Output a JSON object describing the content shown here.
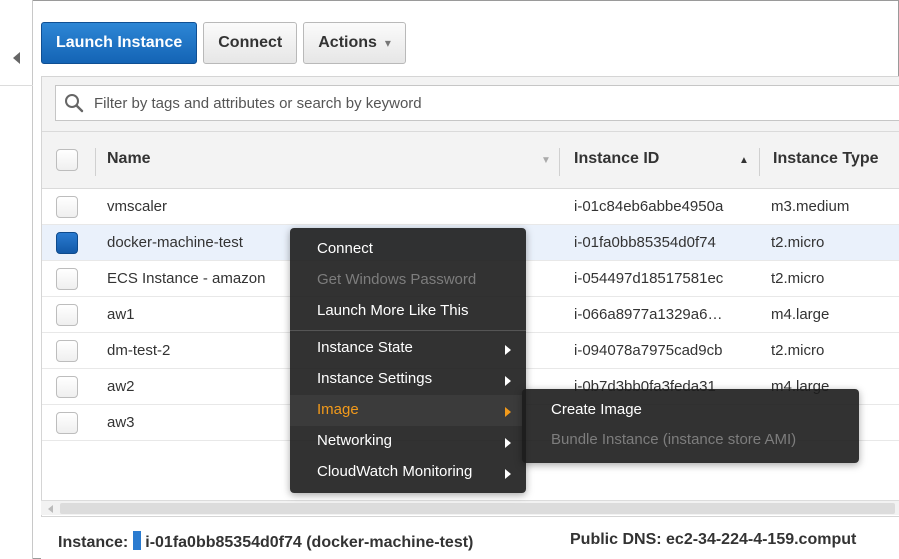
{
  "toolbar": {
    "launch_label": "Launch Instance",
    "connect_label": "Connect",
    "actions_label": "Actions",
    "actions_caret": "▾"
  },
  "filter": {
    "placeholder": "Filter by tags and attributes or search by keyword"
  },
  "table": {
    "columns": [
      "Name",
      "Instance ID",
      "Instance Type"
    ],
    "rows": [
      {
        "name": "vmscaler",
        "id": "i-01c84eb6abbe4950a",
        "type": "m3.medium",
        "selected": false
      },
      {
        "name": "docker-machine-test",
        "id": "i-01fa0bb85354d0f74",
        "type": "t2.micro",
        "selected": true
      },
      {
        "name": "ECS Instance - amazon",
        "id": "i-054497d18517581ec",
        "type": "t2.micro",
        "selected": false
      },
      {
        "name": "aw1",
        "id": "i-066a8977a1329a6…",
        "type": "m4.large",
        "selected": false
      },
      {
        "name": "dm-test-2",
        "id": "i-094078a7975cad9cb",
        "type": "t2.micro",
        "selected": false
      },
      {
        "name": "aw2",
        "id": "i-0b7d3bb0fa3feda31",
        "type": "m4.large",
        "selected": false
      },
      {
        "name": "aw3",
        "id": "",
        "type": "",
        "selected": false
      }
    ]
  },
  "context_menu": {
    "items": [
      {
        "label": "Connect",
        "disabled": false
      },
      {
        "label": "Get Windows Password",
        "disabled": true
      },
      {
        "label": "Launch More Like This",
        "disabled": false
      },
      {
        "label": "Instance State",
        "disabled": false
      },
      {
        "label": "Instance Settings",
        "disabled": false
      },
      {
        "label": "Image",
        "disabled": false,
        "active": true
      },
      {
        "label": "Networking",
        "disabled": false
      },
      {
        "label": "CloudWatch Monitoring",
        "disabled": false
      }
    ],
    "submenu": [
      {
        "label": "Create Image",
        "disabled": false
      },
      {
        "label": "Bundle Instance (instance store AMI)",
        "disabled": true
      }
    ]
  },
  "detail": {
    "instance_label": "Instance:",
    "instance_value": "i-01fa0bb85354d0f74 (docker-machine-test)",
    "dns_label": "Public DNS:",
    "dns_value": "ec2-34-224-4-159.comput"
  },
  "colors": {
    "primary": "#1a6fc4",
    "menu_active": "#f29a1b"
  }
}
